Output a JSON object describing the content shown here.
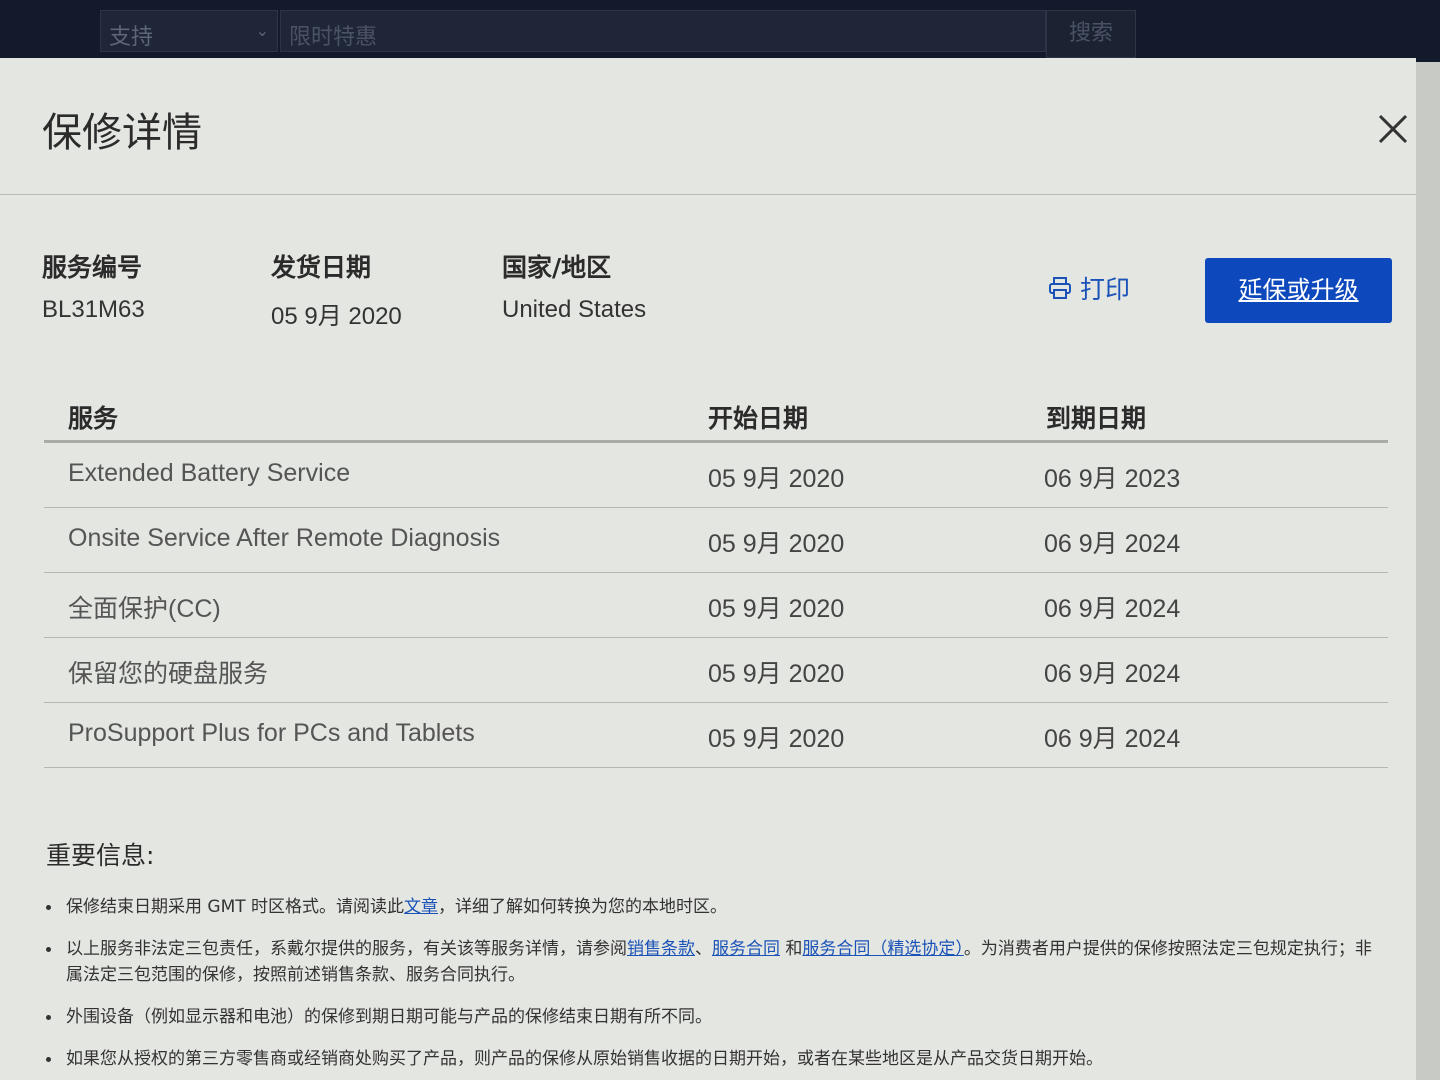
{
  "topbar": {
    "category_select": "支持",
    "search_value": "限时特惠",
    "search_button": "搜索"
  },
  "modal": {
    "title": "保修详情",
    "close_icon": "close-icon"
  },
  "info": {
    "service_tag_label": "服务编号",
    "service_tag_value": "BL31M63",
    "ship_date_label": "发货日期",
    "ship_date_value": "05 9月 2020",
    "country_label": "国家/地区",
    "country_value": "United States",
    "print_label": "打印",
    "print_icon": "printer-icon",
    "upgrade_label": "延保或升级",
    "accent_color": "#0d49bd"
  },
  "table": {
    "headers": {
      "service": "服务",
      "start": "开始日期",
      "end": "到期日期"
    },
    "rows": [
      {
        "service": "Extended Battery Service",
        "start": "05 9月 2020",
        "end": "06 9月 2023"
      },
      {
        "service": "Onsite Service After Remote Diagnosis",
        "start": "05 9月 2020",
        "end": "06 9月 2024"
      },
      {
        "service": "全面保护(CC)",
        "start": "05 9月 2020",
        "end": "06 9月 2024"
      },
      {
        "service": "保留您的硬盘服务",
        "start": "05 9月 2020",
        "end": "06 9月 2024"
      },
      {
        "service": "ProSupport Plus for PCs and Tablets",
        "start": "05 9月 2020",
        "end": "06 9月 2024"
      }
    ]
  },
  "notes": {
    "title": "重要信息:",
    "n1_pre": "保修结束日期采用 GMT 时区格式。请阅读此",
    "n1_link": "文章",
    "n1_post": "，详细了解如何转换为您的本地时区。",
    "n2_pre": "以上服务非法定三包责任，系戴尔提供的服务，有关该等服务详情，请参阅",
    "n2_link1": "销售条款",
    "n2_sep1": "、",
    "n2_link2": "服务合同",
    "n2_sep2": " 和",
    "n2_link3": "服务合同（精选协定）",
    "n2_post": "。为消费者用户提供的保修按照法定三包规定执行；非属法定三包范围的保修，按照前述销售条款、服务合同执行。",
    "n3": "外围设备（例如显示器和电池）的保修到期日期可能与产品的保修结束日期有所不同。",
    "n4": "如果您从授权的第三方零售商或经销商处购买了产品，则产品的保修从原始销售收据的日期开始，或者在某些地区是从产品交货日期开始。"
  }
}
